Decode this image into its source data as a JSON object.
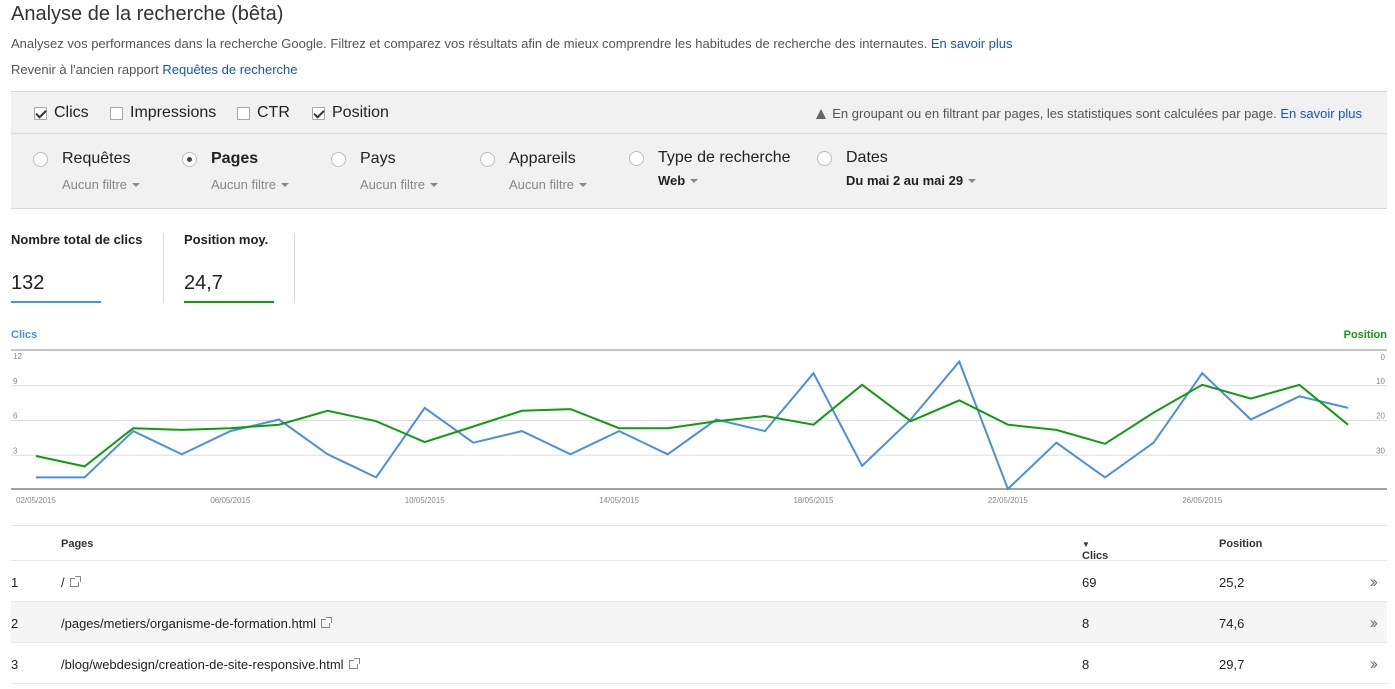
{
  "header": {
    "title": "Analyse de la recherche (bêta)",
    "description": "Analysez vos performances dans la recherche Google. Filtrez et comparez vos résultats afin de mieux comprendre les habitudes de recherche des internautes.",
    "learn_more": "En savoir plus",
    "back_text": "Revenir à l'ancien rapport",
    "back_link": "Requêtes de recherche"
  },
  "metrics": {
    "clics": "Clics",
    "impressions": "Impressions",
    "ctr": "CTR",
    "position": "Position",
    "notice": "En groupant ou en filtrant par pages, les statistiques sont calculées par page.",
    "notice_link": "En savoir plus"
  },
  "dimensions": {
    "requetes": {
      "label": "Requêtes",
      "filter": "Aucun filtre"
    },
    "pages": {
      "label": "Pages",
      "filter": "Aucun filtre"
    },
    "pays": {
      "label": "Pays",
      "filter": "Aucun filtre"
    },
    "appareils": {
      "label": "Appareils",
      "filter": "Aucun filtre"
    },
    "type": {
      "label": "Type de recherche",
      "filter": "Web"
    },
    "dates": {
      "label": "Dates",
      "filter": "Du mai 2 au mai 29"
    }
  },
  "summary": {
    "clicks_label": "Nombre total de clics",
    "clicks_value": "132",
    "position_label": "Position moy.",
    "position_value": "24,7"
  },
  "colors": {
    "clicks": "#4a90e2",
    "position": "#129a12"
  },
  "chart_data": {
    "type": "line",
    "left_axis_label": "Clics",
    "right_axis_label": "Position",
    "y_left_ticks": [
      12,
      9,
      6,
      3
    ],
    "y_right_ticks": [
      0,
      10,
      20,
      30
    ],
    "ylim_left": [
      0,
      12
    ],
    "ylim_right": [
      0,
      40
    ],
    "x_tick_labels": [
      "02/05/2015",
      "06/05/2015",
      "10/05/2015",
      "14/05/2015",
      "18/05/2015",
      "22/05/2015",
      "26/05/2015"
    ],
    "x": [
      "02/05/2015",
      "03/05/2015",
      "04/05/2015",
      "05/05/2015",
      "06/05/2015",
      "07/05/2015",
      "08/05/2015",
      "09/05/2015",
      "10/05/2015",
      "11/05/2015",
      "12/05/2015",
      "13/05/2015",
      "14/05/2015",
      "15/05/2015",
      "16/05/2015",
      "17/05/2015",
      "18/05/2015",
      "19/05/2015",
      "20/05/2015",
      "21/05/2015",
      "22/05/2015",
      "23/05/2015",
      "24/05/2015",
      "25/05/2015",
      "26/05/2015",
      "27/05/2015",
      "28/05/2015",
      "29/05/2015"
    ],
    "series": [
      {
        "name": "Clics",
        "axis": "left",
        "values": [
          1,
          1,
          5,
          3,
          5,
          6,
          3,
          1,
          7,
          4,
          5,
          3,
          5,
          3,
          6,
          5,
          10,
          2,
          6,
          11,
          0,
          4,
          1,
          4,
          10,
          6,
          8,
          7
        ]
      },
      {
        "name": "Position",
        "axis": "right",
        "values": [
          30.5,
          33.5,
          22.5,
          23,
          22.5,
          21.5,
          17.5,
          20.5,
          26.5,
          22,
          17.5,
          17,
          22.5,
          22.5,
          20.5,
          19,
          21.5,
          10,
          20.5,
          14.5,
          21.5,
          23,
          27,
          18,
          10,
          14,
          10,
          21.5
        ]
      }
    ],
    "grid": true
  },
  "table": {
    "col_pages": "Pages",
    "col_clicks": "Clics",
    "col_position": "Position",
    "rows": [
      {
        "rank": "1",
        "page": "/",
        "clicks": "69",
        "position": "25,2"
      },
      {
        "rank": "2",
        "page": "/pages/metiers/organisme-de-formation.html",
        "clicks": "8",
        "position": "74,6"
      },
      {
        "rank": "3",
        "page": "/blog/webdesign/creation-de-site-responsive.html",
        "clicks": "8",
        "position": "29,7"
      }
    ]
  }
}
